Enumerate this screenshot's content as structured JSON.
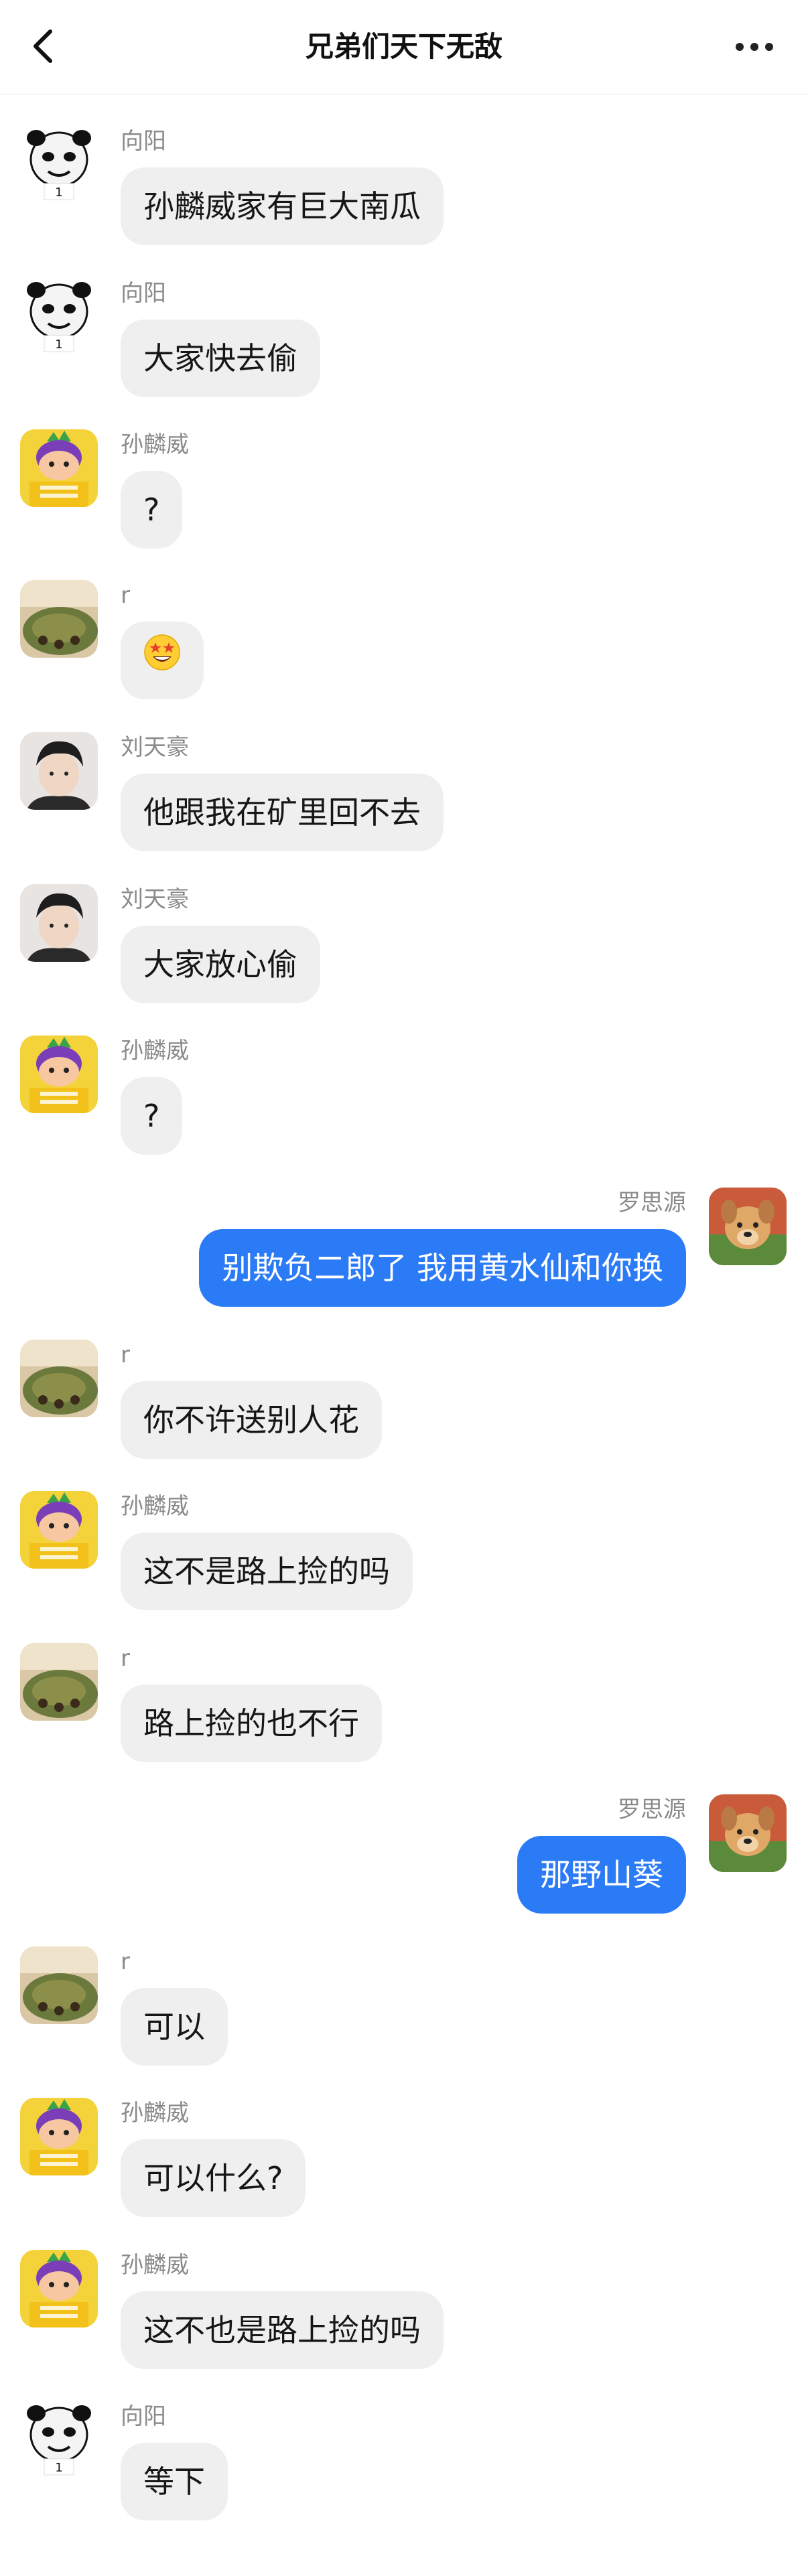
{
  "header": {
    "title": "兄弟们天下无敌",
    "back_icon": "chevron-left-icon",
    "more_icon": "more-horizontal-icon"
  },
  "messages": [
    {
      "sender": "向阳",
      "text": "孙麟威家有巨大南瓜",
      "direction": "in",
      "avatar": "panda-meme-avatar",
      "avatar_badge": "1"
    },
    {
      "sender": "向阳",
      "text": "大家快去偷",
      "direction": "in",
      "avatar": "panda-meme-avatar",
      "avatar_badge": "1"
    },
    {
      "sender": "孙麟威",
      "text": "?",
      "direction": "in",
      "avatar": "cartoon-pineapple-avatar"
    },
    {
      "sender": "r",
      "text": "",
      "emoji": "star-struck-emoji",
      "direction": "in",
      "avatar": "food-photo-avatar"
    },
    {
      "sender": "刘天豪",
      "text": "他跟我在矿里回不去",
      "direction": "in",
      "avatar": "boy-photo-avatar"
    },
    {
      "sender": "刘天豪",
      "text": "大家放心偷",
      "direction": "in",
      "avatar": "boy-photo-avatar"
    },
    {
      "sender": "孙麟威",
      "text": "?",
      "direction": "in",
      "avatar": "cartoon-pineapple-avatar"
    },
    {
      "sender": "罗思源",
      "text": "别欺负二郎了 我用黄水仙和你换",
      "direction": "out",
      "avatar": "dog-photo-avatar"
    },
    {
      "sender": "r",
      "text": "你不许送别人花",
      "direction": "in",
      "avatar": "food-photo-avatar"
    },
    {
      "sender": "孙麟威",
      "text": "这不是路上捡的吗",
      "direction": "in",
      "avatar": "cartoon-pineapple-avatar"
    },
    {
      "sender": "r",
      "text": "路上捡的也不行",
      "direction": "in",
      "avatar": "food-photo-avatar"
    },
    {
      "sender": "罗思源",
      "text": "那野山葵",
      "direction": "out",
      "avatar": "dog-photo-avatar"
    },
    {
      "sender": "r",
      "text": "可以",
      "direction": "in",
      "avatar": "food-photo-avatar"
    },
    {
      "sender": "孙麟威",
      "text": "可以什么?",
      "direction": "in",
      "avatar": "cartoon-pineapple-avatar"
    },
    {
      "sender": "孙麟威",
      "text": "这不也是路上捡的吗",
      "direction": "in",
      "avatar": "cartoon-pineapple-avatar"
    },
    {
      "sender": "向阳",
      "text": "等下",
      "direction": "in",
      "avatar": "panda-meme-avatar",
      "avatar_badge": "1"
    }
  ],
  "colors": {
    "outgoing_bubble": "#2b7bf7",
    "incoming_bubble": "#efefef",
    "sender_name": "#8a8a8a"
  }
}
